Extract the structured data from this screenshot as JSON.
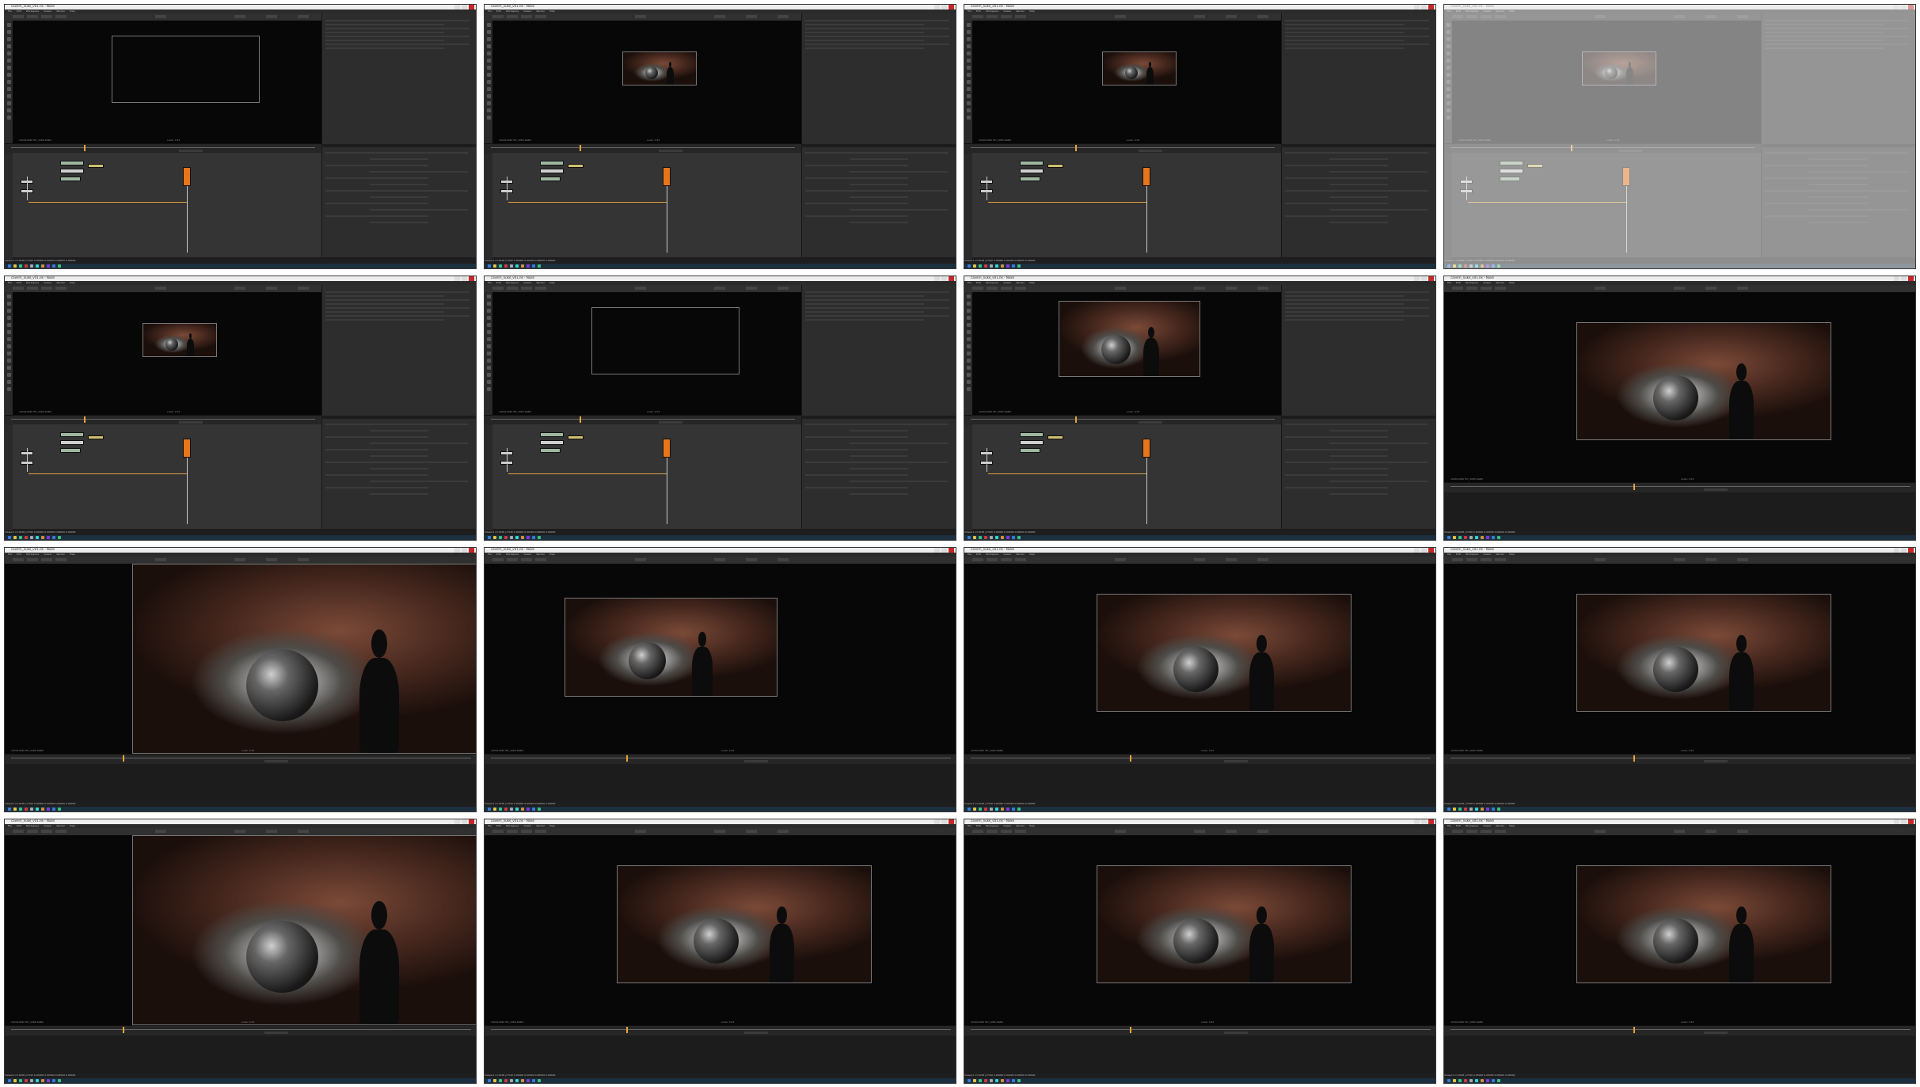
{
  "window": {
    "title": "cavern_nuke_v01.nk - Nuke",
    "menu": [
      "File",
      "Edit",
      "Workspace",
      "Viewer",
      "Render",
      "Help"
    ]
  },
  "viewer": {
    "status": "1920x1080 HD_1080 RGBA",
    "zoom": "scale: 0.25"
  },
  "console": {
    "line": "Viewer1 x=1048 y=540  0.00000 0.00000 0.00000 0.00000"
  },
  "colors": {
    "node_orange": "#e8751a",
    "timeline_cursor": "#e8a33a",
    "taskbar": "#1c2f3f"
  },
  "frames": [
    {
      "mode": "comp-empty"
    },
    {
      "mode": "comp-small"
    },
    {
      "mode": "comp-small"
    },
    {
      "mode": "comp-dim"
    },
    {
      "mode": "comp-small"
    },
    {
      "mode": "comp-empty"
    },
    {
      "mode": "comp-wide"
    },
    {
      "mode": "viewer-medium"
    },
    {
      "mode": "viewer-zoomed"
    },
    {
      "mode": "viewer-small"
    },
    {
      "mode": "viewer-medium"
    },
    {
      "mode": "viewer-medium"
    },
    {
      "mode": "viewer-zoomed"
    },
    {
      "mode": "viewer-medium"
    },
    {
      "mode": "viewer-medium"
    },
    {
      "mode": "viewer-medium"
    }
  ]
}
